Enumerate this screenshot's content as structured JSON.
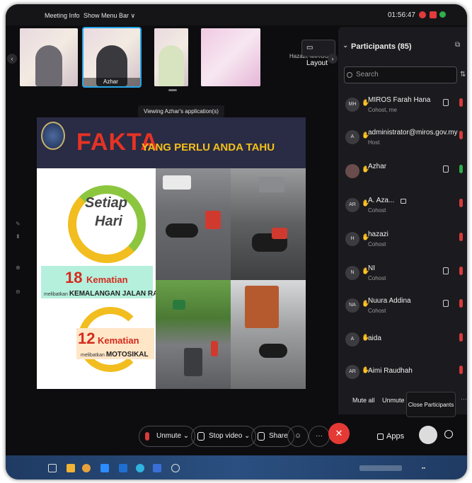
{
  "topbar": {
    "meeting_info": "Meeting Info",
    "show_menu_bar": "Show Menu Bar ∨",
    "time": "01:56:47"
  },
  "thumbnails": {
    "azhar_name": "Azhar",
    "hazazi_label": "Hazazi, MIROS",
    "layout_label": "Layout"
  },
  "viewing_tooltip": "Viewing Azhar's application(s)",
  "slide": {
    "title_fakta": "FAKTA",
    "title_rest": "YANG PERLU ANDA TAHU",
    "setiap": "Setiap",
    "hari": "Hari",
    "stat1_number": "18",
    "stat1_label": "Kematian",
    "stat1_sub_small": "melibatkan",
    "stat1_sub_bold": "KEMALANGAN JALAN RAYA",
    "stat2_number": "12",
    "stat2_label": "Kematian",
    "stat2_sub_small": "melibatkan",
    "stat2_sub_bold": "MOTOSIKAL"
  },
  "participants": {
    "title": "Participants (85)",
    "search_placeholder": "Search",
    "list": [
      {
        "initials": "MH",
        "name": "MIROS Farah Hana",
        "role": "Cohost, me",
        "mic": "muted"
      },
      {
        "initials": "A",
        "name": "administrator@miros.gov.my",
        "role": "Host",
        "mic": "muted"
      },
      {
        "initials": "",
        "name": "Azhar",
        "role": "",
        "mic": "on"
      },
      {
        "initials": "AR",
        "name": "A. Aza...",
        "role": "Cohost",
        "mic": "muted"
      },
      {
        "initials": "H",
        "name": "hazazi",
        "role": "Cohost",
        "mic": "muted"
      },
      {
        "initials": "N",
        "name": "NI",
        "role": "Cohost",
        "mic": "muted"
      },
      {
        "initials": "NA",
        "name": "Nuura Addina",
        "role": "Cohost",
        "mic": "muted"
      },
      {
        "initials": "A",
        "name": "aida",
        "role": "",
        "mic": "muted"
      },
      {
        "initials": "AR",
        "name": "Aimi Raudhah",
        "role": "",
        "mic": "muted"
      }
    ],
    "mute_all": "Mute all",
    "unmute_all": "Unmute all",
    "close_tooltip": "Close Participants"
  },
  "toolbar": {
    "unmute": "Unmute",
    "stop_video": "Stop video",
    "share": "Share",
    "apps": "Apps"
  },
  "colors": {
    "end_button": "#e53935",
    "mic_muted": "#d83b3b",
    "mic_on": "#2fae4a",
    "fakta_red": "#e63324",
    "title_yellow": "#f3c01a"
  }
}
